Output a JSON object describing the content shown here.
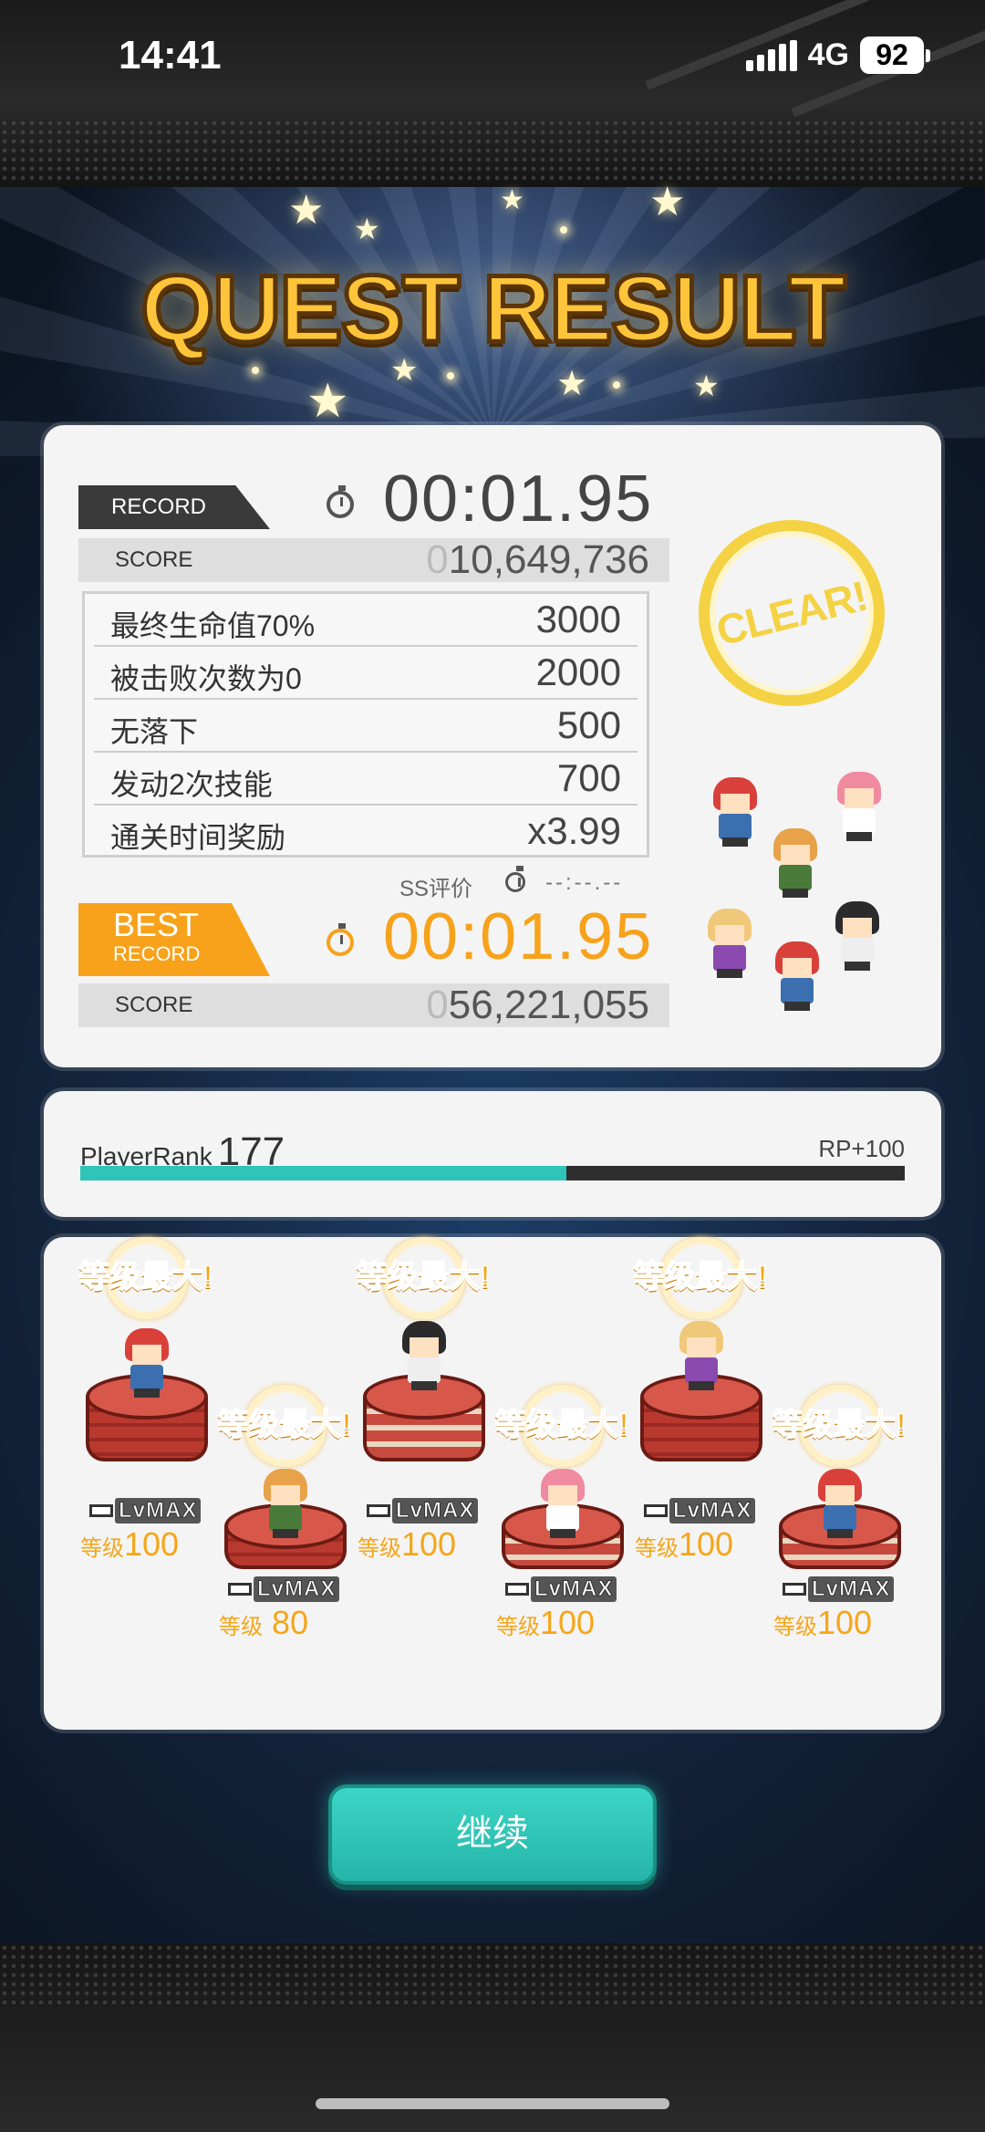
{
  "status": {
    "time": "14:41",
    "network": "4G",
    "battery": "92"
  },
  "title": "QUEST RESULT",
  "record": {
    "label": "RECORD",
    "time": "00:01.95",
    "score_label": "SCORE",
    "score_leading": "0",
    "score": "10,649,736",
    "bonuses": [
      {
        "name": "最终生命值70%",
        "points": "3000"
      },
      {
        "name": "被击败次数为0",
        "points": "2000"
      },
      {
        "name": "无落下",
        "points": "500"
      },
      {
        "name": "发动2次技能",
        "points": "700"
      },
      {
        "name": "通关时间奖励",
        "points": "x3.99"
      }
    ],
    "ss_label": "SS评价",
    "ss_time": "--:--.--",
    "clear_stamp": "CLEAR!"
  },
  "best": {
    "label_top": "BEST",
    "label_bottom": "RECORD",
    "time": "00:01.95",
    "score_label": "SCORE",
    "score_leading": "0",
    "score": "56,221,055"
  },
  "player_rank": {
    "label": "PlayerRank",
    "value": "177",
    "rp": "RP+100",
    "progress": 0.59
  },
  "units": [
    {
      "max_text": "等级最大!",
      "lv_badge": "LvMAX",
      "lv_prefix": "等级",
      "level": "100",
      "hair": "#d9403a"
    },
    {
      "max_text": "等级最大!",
      "lv_badge": "LvMAX",
      "lv_prefix": "等级",
      "level": " 80",
      "hair": "#e8a24a"
    },
    {
      "max_text": "等级最大!",
      "lv_badge": "LvMAX",
      "lv_prefix": "等级",
      "level": "100",
      "hair": "#2b2b2b"
    },
    {
      "max_text": "等级最大!",
      "lv_badge": "LvMAX",
      "lv_prefix": "等级",
      "level": "100",
      "hair": "#f08aa0"
    },
    {
      "max_text": "等级最大!",
      "lv_badge": "LvMAX",
      "lv_prefix": "等级",
      "level": "100",
      "hair": "#f0c87a"
    },
    {
      "max_text": "等级最大!",
      "lv_badge": "LvMAX",
      "lv_prefix": "等级",
      "level": "100",
      "hair": "#d9403a"
    }
  ],
  "continue_label": "继续",
  "colors": {
    "accent_orange": "#f7a21a",
    "teal": "#2fc4b8",
    "gold": "#ffc53a"
  }
}
